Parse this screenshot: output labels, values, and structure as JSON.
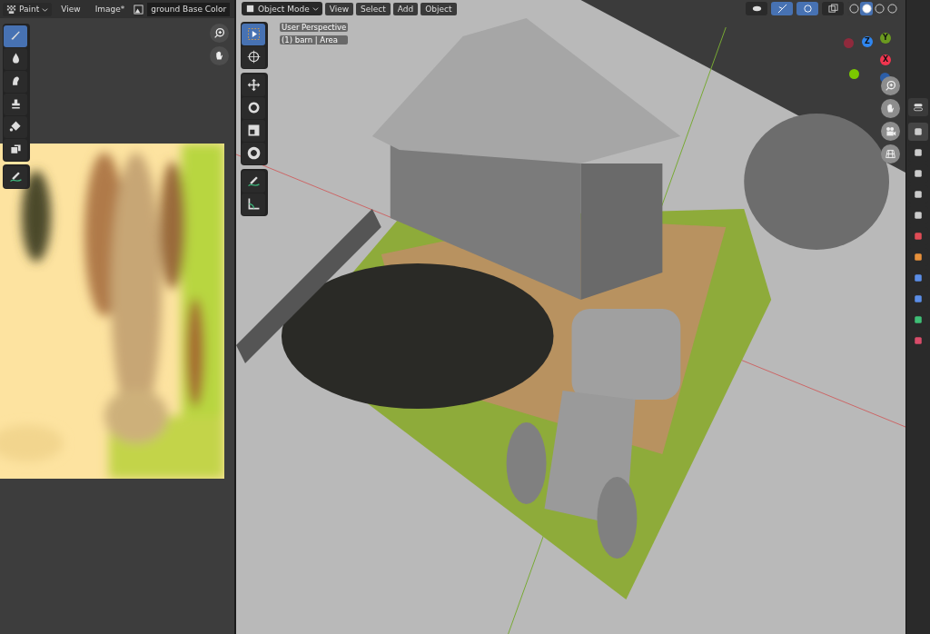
{
  "image_editor": {
    "header": {
      "mode": "Paint",
      "menus": [
        "View",
        "Image*"
      ],
      "image_name": "ground Base Color"
    },
    "tools": [
      {
        "selected": true
      },
      {
        "selected": false
      },
      {
        "selected": false
      },
      {
        "selected": false
      },
      {
        "selected": false
      },
      {
        "selected": false
      }
    ],
    "annotate_tool": {
      "selected": false
    }
  },
  "viewport": {
    "header": {
      "mode": "Object Mode",
      "menus": [
        "View",
        "Select",
        "Add",
        "Object"
      ]
    },
    "toggles": [
      {
        "on": false
      },
      {
        "on": true
      },
      {
        "on": true
      },
      {
        "on": false
      }
    ],
    "shading": [
      {
        "selected": false
      },
      {
        "selected": true
      },
      {
        "selected": false
      },
      {
        "selected": false
      }
    ],
    "info": [
      "User Perspective",
      "(1) barn | Area"
    ],
    "tools": [
      {
        "selected": true
      },
      {
        "selected": false
      }
    ],
    "transform_tools": [
      {
        "selected": false
      },
      {
        "selected": false
      },
      {
        "selected": false
      },
      {
        "selected": false
      }
    ],
    "draw_tools": [
      {
        "selected": false
      },
      {
        "selected": false
      }
    ],
    "gizmo_axes": [
      {
        "label": "Z",
        "color": "#2f86f0"
      },
      {
        "label": "Y",
        "color": "#6b9a1f"
      },
      {
        "label": "X",
        "color": "#f0354f"
      }
    ]
  },
  "properties_tabs": [
    {
      "selected": true
    },
    {
      "selected": false
    },
    {
      "selected": false
    },
    {
      "selected": false
    },
    {
      "selected": false
    },
    {
      "selected": false
    },
    {
      "selected": false
    },
    {
      "selected": false
    },
    {
      "selected": false
    },
    {
      "selected": false
    },
    {
      "selected": false
    }
  ]
}
